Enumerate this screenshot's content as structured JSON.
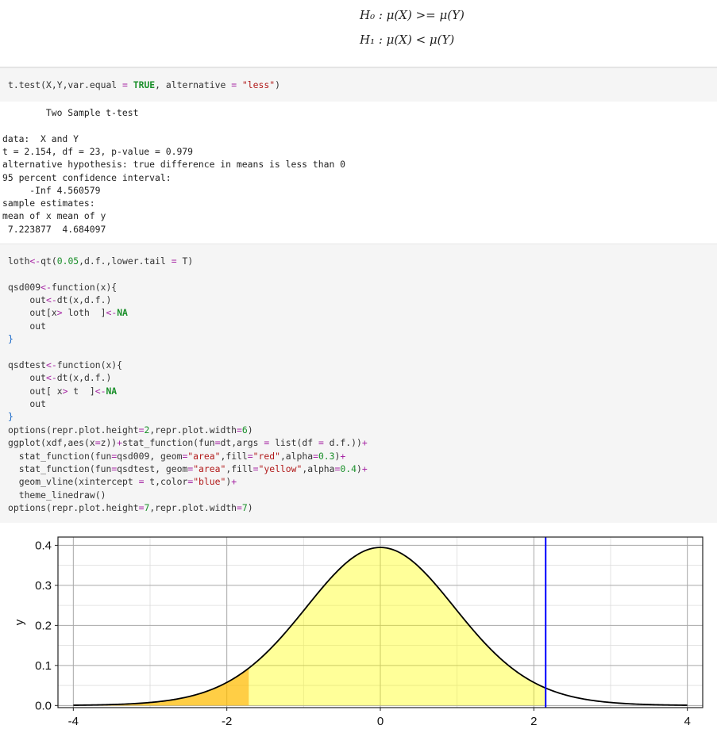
{
  "math": {
    "h0": "H₀ : μ(X) >= μ(Y)",
    "h1": "H₁ : μ(X) < μ(Y)"
  },
  "cell1": {
    "lines": [
      [
        {
          "t": "t.test(X,Y,var.equal ",
          "c": ""
        },
        {
          "t": "=",
          "c": "op"
        },
        {
          "t": " ",
          "c": ""
        },
        {
          "t": "TRUE",
          "c": "kw"
        },
        {
          "t": ", alternative ",
          "c": ""
        },
        {
          "t": "=",
          "c": "op"
        },
        {
          "t": " ",
          "c": ""
        },
        {
          "t": "\"less\"",
          "c": "str"
        },
        {
          "t": ")",
          "c": ""
        }
      ]
    ]
  },
  "output": {
    "lines": [
      "        Two Sample t-test",
      "",
      "data:  X and Y",
      "t = 2.154, df = 23, p-value = 0.979",
      "alternative hypothesis: true difference in means is less than 0",
      "95 percent confidence interval:",
      "     -Inf 4.560579",
      "sample estimates:",
      "mean of x mean of y",
      " 7.223877  4.684097"
    ]
  },
  "cell2": {
    "lines": [
      [
        {
          "t": "loth",
          "c": ""
        },
        {
          "t": "<-",
          "c": "op"
        },
        {
          "t": "qt(",
          "c": ""
        },
        {
          "t": "0.05",
          "c": "num"
        },
        {
          "t": ",d.f.,lower.tail ",
          "c": ""
        },
        {
          "t": "=",
          "c": "op"
        },
        {
          "t": " T)",
          "c": ""
        }
      ],
      [],
      [
        {
          "t": "qsd009",
          "c": ""
        },
        {
          "t": "<-",
          "c": "op"
        },
        {
          "t": "function(x){",
          "c": ""
        }
      ],
      [
        {
          "t": "    out",
          "c": ""
        },
        {
          "t": "<-",
          "c": "op"
        },
        {
          "t": "dt(x,d.f.)",
          "c": ""
        }
      ],
      [
        {
          "t": "    out[x",
          "c": ""
        },
        {
          "t": ">",
          "c": "op"
        },
        {
          "t": " loth  ]",
          "c": ""
        },
        {
          "t": "<-",
          "c": "op"
        },
        {
          "t": "NA",
          "c": "kw"
        }
      ],
      [
        {
          "t": "    out",
          "c": ""
        }
      ],
      [
        {
          "t": "}",
          "c": "brace"
        }
      ],
      [],
      [
        {
          "t": "qsdtest",
          "c": ""
        },
        {
          "t": "<-",
          "c": "op"
        },
        {
          "t": "function(x){",
          "c": ""
        }
      ],
      [
        {
          "t": "    out",
          "c": ""
        },
        {
          "t": "<-",
          "c": "op"
        },
        {
          "t": "dt(x,d.f.)",
          "c": ""
        }
      ],
      [
        {
          "t": "    out[ x",
          "c": ""
        },
        {
          "t": ">",
          "c": "op"
        },
        {
          "t": " t  ]",
          "c": ""
        },
        {
          "t": "<-",
          "c": "op"
        },
        {
          "t": "NA",
          "c": "kw"
        }
      ],
      [
        {
          "t": "    out",
          "c": ""
        }
      ],
      [
        {
          "t": "}",
          "c": "brace"
        }
      ],
      [
        {
          "t": "options(repr.plot.height",
          "c": ""
        },
        {
          "t": "=",
          "c": "op"
        },
        {
          "t": "2",
          "c": "num"
        },
        {
          "t": ",repr.plot.width",
          "c": ""
        },
        {
          "t": "=",
          "c": "op"
        },
        {
          "t": "6",
          "c": "num"
        },
        {
          "t": ")",
          "c": ""
        }
      ],
      [
        {
          "t": "ggplot(xdf,aes(x",
          "c": ""
        },
        {
          "t": "=",
          "c": "op"
        },
        {
          "t": "z))",
          "c": ""
        },
        {
          "t": "+",
          "c": "op"
        },
        {
          "t": "stat_function(fun",
          "c": ""
        },
        {
          "t": "=",
          "c": "op"
        },
        {
          "t": "dt,args ",
          "c": ""
        },
        {
          "t": "=",
          "c": "op"
        },
        {
          "t": " list(df ",
          "c": ""
        },
        {
          "t": "=",
          "c": "op"
        },
        {
          "t": " d.f.))",
          "c": ""
        },
        {
          "t": "+",
          "c": "op"
        }
      ],
      [
        {
          "t": "  stat_function(fun",
          "c": ""
        },
        {
          "t": "=",
          "c": "op"
        },
        {
          "t": "qsd009, geom",
          "c": ""
        },
        {
          "t": "=",
          "c": "op"
        },
        {
          "t": "\"area\"",
          "c": "str"
        },
        {
          "t": ",fill",
          "c": ""
        },
        {
          "t": "=",
          "c": "op"
        },
        {
          "t": "\"red\"",
          "c": "str"
        },
        {
          "t": ",alpha",
          "c": ""
        },
        {
          "t": "=",
          "c": "op"
        },
        {
          "t": "0.3",
          "c": "num"
        },
        {
          "t": ")",
          "c": ""
        },
        {
          "t": "+",
          "c": "op"
        }
      ],
      [
        {
          "t": "  stat_function(fun",
          "c": ""
        },
        {
          "t": "=",
          "c": "op"
        },
        {
          "t": "qsdtest, geom",
          "c": ""
        },
        {
          "t": "=",
          "c": "op"
        },
        {
          "t": "\"area\"",
          "c": "str"
        },
        {
          "t": ",fill",
          "c": ""
        },
        {
          "t": "=",
          "c": "op"
        },
        {
          "t": "\"yellow\"",
          "c": "str"
        },
        {
          "t": ",alpha",
          "c": ""
        },
        {
          "t": "=",
          "c": "op"
        },
        {
          "t": "0.4",
          "c": "num"
        },
        {
          "t": ")",
          "c": ""
        },
        {
          "t": "+",
          "c": "op"
        }
      ],
      [
        {
          "t": "  geom_vline(xintercept ",
          "c": ""
        },
        {
          "t": "=",
          "c": "op"
        },
        {
          "t": " t,color",
          "c": ""
        },
        {
          "t": "=",
          "c": "op"
        },
        {
          "t": "\"blue\"",
          "c": "str"
        },
        {
          "t": ")",
          "c": ""
        },
        {
          "t": "+",
          "c": "op"
        }
      ],
      [
        {
          "t": "  theme_linedraw()",
          "c": ""
        }
      ],
      [
        {
          "t": "options(repr.plot.height",
          "c": ""
        },
        {
          "t": "=",
          "c": "op"
        },
        {
          "t": "7",
          "c": "num"
        },
        {
          "t": ",repr.plot.width",
          "c": ""
        },
        {
          "t": "=",
          "c": "op"
        },
        {
          "t": "7",
          "c": "num"
        },
        {
          "t": ")",
          "c": ""
        }
      ]
    ]
  },
  "chart_data": {
    "type": "area",
    "title": "",
    "xlabel": "",
    "ylabel": "y",
    "xlim": [
      -4.2,
      4.2
    ],
    "ylim": [
      -0.0053,
      0.4206
    ],
    "x_ticks": [
      -4,
      -2,
      0,
      2,
      4
    ],
    "x_tick_labels": [
      "-4",
      "-2",
      "0",
      "2",
      "4"
    ],
    "y_ticks": [
      0.0,
      0.1,
      0.2,
      0.3,
      0.4
    ],
    "y_tick_labels": [
      "0.0",
      "0.1",
      "0.2",
      "0.3",
      "0.4"
    ],
    "grid": true,
    "series": [
      {
        "curve": "t-density",
        "df": 23,
        "x_range": [
          -4,
          4
        ],
        "line_color": "#000000"
      },
      {
        "curve": "t-density",
        "df": 23,
        "x_range": [
          -4,
          -1.714
        ],
        "fill": "#ffa500",
        "fill_note": "red alpha 0.3 over yellow"
      },
      {
        "curve": "t-density",
        "df": 23,
        "x_range": [
          -4,
          2.154
        ],
        "fill": "#ffff00",
        "alpha": 0.4
      }
    ],
    "vline": {
      "x": 2.154,
      "color": "#0000ff"
    }
  }
}
